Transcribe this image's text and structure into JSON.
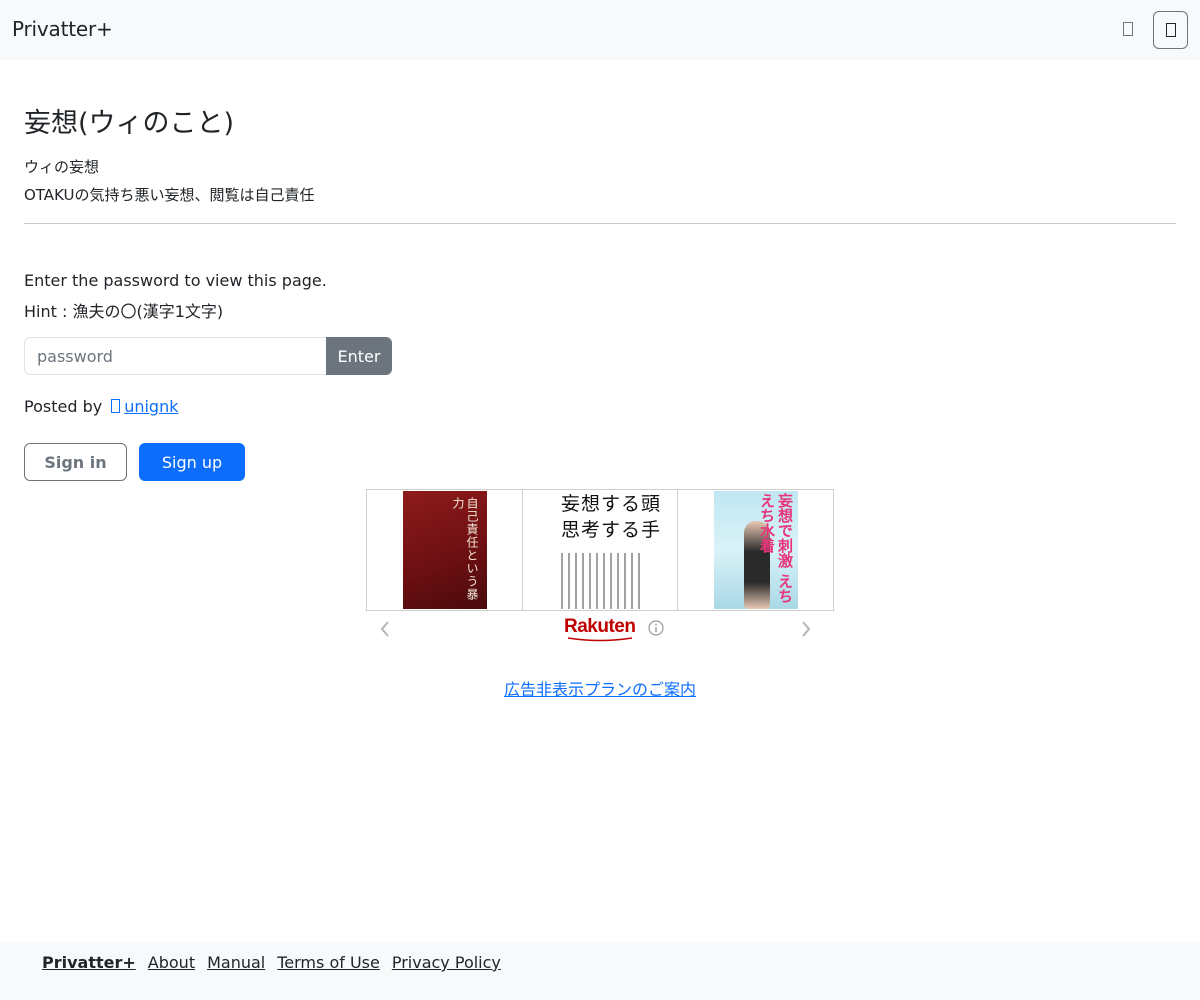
{
  "navbar": {
    "brand": "Privatter+"
  },
  "post": {
    "title": "妄想(ウィのこと)",
    "description_lines": [
      "ウィの妄想",
      "OTAKUの気持ち悪い妄想、閲覧は自己責任"
    ]
  },
  "password_gate": {
    "message": "Enter the password to view this page.",
    "hint": "Hint : 漁夫の〇(漢字1文字)",
    "placeholder": "password",
    "submit_label": "Enter"
  },
  "author": {
    "posted_by_label": "Posted by",
    "name": "unignk",
    "icon": "twitter-icon"
  },
  "auth": {
    "sign_in_label": "Sign in",
    "sign_up_label": "Sign up"
  },
  "ad": {
    "brand": "Rakuten",
    "books": [
      {
        "title": "自己責任という暴力"
      },
      {
        "title": "妄想する頭 思考する手"
      },
      {
        "title": "妄想で刺激 えちえち水着"
      }
    ],
    "no_ads_link": "広告非表示プランのご案内"
  },
  "footer": {
    "links": [
      "Privatter+",
      "About",
      "Manual",
      "Terms of Use",
      "Privacy Policy"
    ]
  },
  "colors": {
    "primary": "#0d6efd",
    "secondary": "#6c757d",
    "navbar_bg": "#f8f9fa",
    "rakuten_red": "#bf0000"
  }
}
